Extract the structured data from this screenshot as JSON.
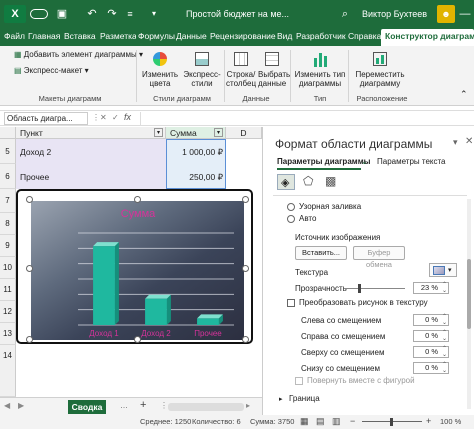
{
  "titlebar": {
    "autosave": "Автосохранение",
    "filename": "Простой бюджет на ме...",
    "user": "Виктор Бухтеев",
    "minimize": "—"
  },
  "tabs": [
    "Файл",
    "Главная",
    "Вставка",
    "Разметка страницы",
    "Формулы",
    "Данные",
    "Рецензирование",
    "Вид",
    "Разработчик",
    "Справка",
    "Конструктор диаграмм"
  ],
  "ribbon": {
    "add_element": "Добавить элемент диаграммы",
    "express_layout": "Экспресс-макет",
    "group1": "Макеты диаграмм",
    "change_colors": "Изменить цвета",
    "express_styles": "Экспресс-стили",
    "group2": "Стили диаграмм",
    "row_col": "Строка/столбец",
    "select_data": "Выбрать данные",
    "group3": "Данные",
    "change_type": "Изменить тип диаграммы",
    "group4": "Тип",
    "move_chart": "Переместить диаграмму",
    "group5": "Расположение"
  },
  "formula_bar": {
    "namebox": "Область диагра...",
    "fx": "fx"
  },
  "grid": {
    "col_a": "Пункт",
    "col_b": "Сумма",
    "col_c": "D",
    "rows": [
      {
        "num": "5",
        "a": "Доход 2",
        "b": "1 000,00 ₽"
      },
      {
        "num": "6",
        "a": "Прочее",
        "b": "250,00 ₽"
      }
    ],
    "row_nums": [
      "7",
      "8",
      "9",
      "10",
      "11",
      "12",
      "13",
      "14"
    ]
  },
  "chart_data": {
    "type": "bar",
    "title": "Сумма",
    "categories": [
      "Доход 1",
      "Доход 2",
      "Прочее"
    ],
    "values": [
      3000,
      1000,
      250
    ],
    "ylim": [
      0,
      3500
    ],
    "gridlines": 6,
    "label_color": "#d6339a",
    "bar_color": "#1fb89f"
  },
  "sheet": {
    "tab": "Сводка",
    "add": "+"
  },
  "status": {
    "avg": "Среднее: 1250",
    "count": "Количество: 6",
    "sum": "Сумма: 3750",
    "zoom": "100 %"
  },
  "pane": {
    "title": "Формат области диаграммы",
    "tab1": "Параметры диаграммы",
    "tab2": "Параметры текста",
    "pattern_fill": "Узорная заливка",
    "auto": "Авто",
    "source": "Источник изображения",
    "insert": "Вставить...",
    "clipboard": "Буфер обмена",
    "texture": "Текстура",
    "transparency": "Прозрачность",
    "transparency_value": "23 %",
    "transparency_fraction": 0.23,
    "tile": "Преобразовать рисунок в текстуру",
    "left_offset": "Слева со смещением",
    "right_offset": "Справа со смещением",
    "top_offset": "Сверху со смещением",
    "bottom_offset": "Снизу со смещением",
    "offset_value": "0 %",
    "rotate": "Повернуть вместе с фигурой",
    "border": "Граница"
  }
}
